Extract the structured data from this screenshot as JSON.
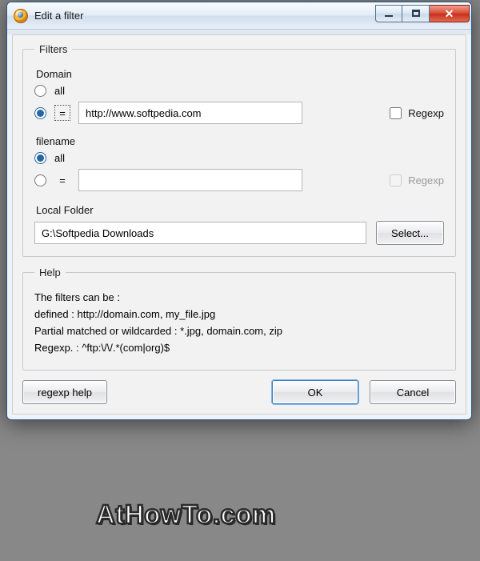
{
  "window": {
    "title": "Edit a filter"
  },
  "filters": {
    "legend": "Filters",
    "domain": {
      "label": "Domain",
      "option_all": "all",
      "option_eq": "=",
      "selected": "eq",
      "value": "http://www.softpedia.com",
      "regexp_label": "Regexp",
      "regexp_checked": false
    },
    "filename": {
      "label": "filename",
      "option_all": "all",
      "option_eq": "=",
      "selected": "all",
      "value": "",
      "regexp_label": "Regexp",
      "regexp_checked": false
    },
    "local_folder": {
      "label": "Local Folder",
      "value": "G:\\Softpedia Downloads",
      "select_button": "Select..."
    }
  },
  "help": {
    "legend": "Help",
    "line1": "The filters can be :",
    "line2": "defined : http://domain.com, my_file.jpg",
    "line3": "Partial matched or wildcarded : *.jpg, domain.com, zip",
    "line4": "Regexp. : ^ftp:\\/\\/.*(com|org)$"
  },
  "buttons": {
    "regexp_help": "regexp help",
    "ok": "OK",
    "cancel": "Cancel"
  },
  "watermark": "AtHowTo.com"
}
